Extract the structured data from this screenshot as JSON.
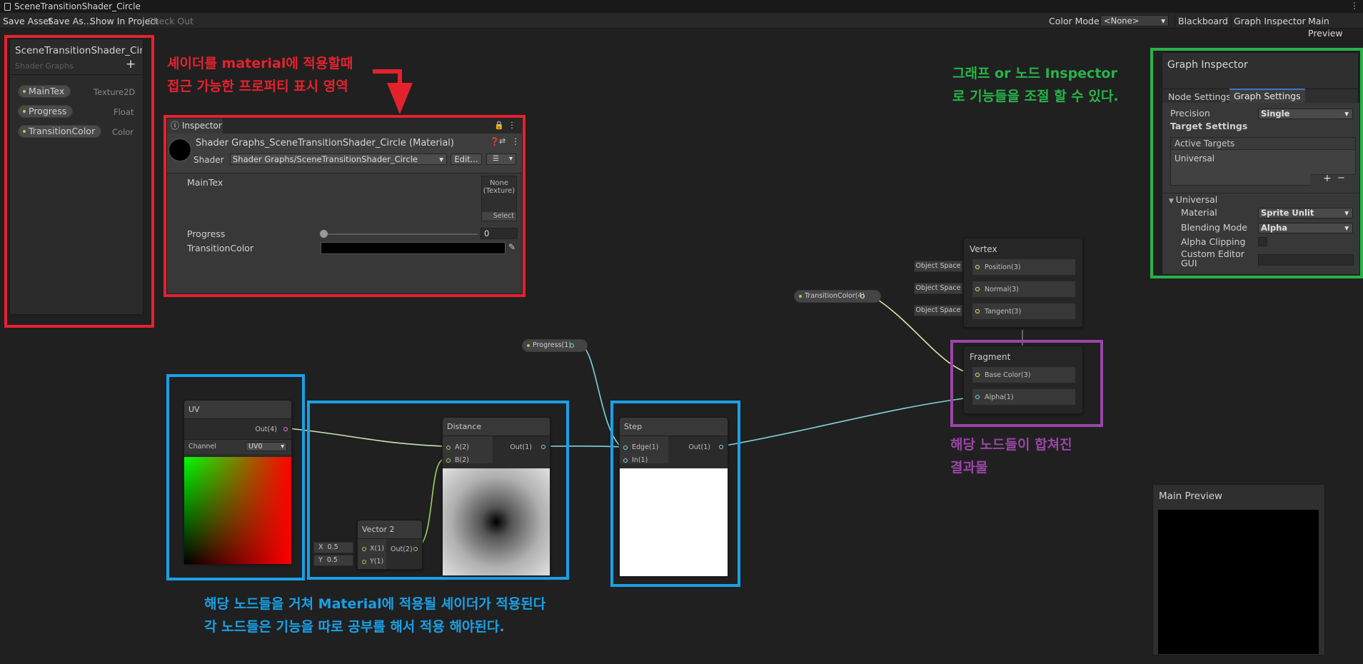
{
  "window": {
    "title": "SceneTransitionShader_Circle"
  },
  "toolbar": {
    "save_asset": "Save Asset",
    "save_as": "Save As...",
    "show_in_project": "Show In Project",
    "check_out": "Check Out",
    "color_mode_label": "Color Mode",
    "color_mode_value": "<None>",
    "blackboard": "Blackboard",
    "graph_inspector": "Graph Inspector",
    "main_preview": "Main Preview"
  },
  "blackboard": {
    "title": "SceneTransitionShader_Cir",
    "subtitle": "Shader Graphs",
    "add": "+",
    "properties": [
      {
        "name": "MainTex",
        "type": "Texture2D"
      },
      {
        "name": "Progress",
        "type": "Float"
      },
      {
        "name": "TransitionColor",
        "type": "Color"
      }
    ]
  },
  "inspector": {
    "tab": "Inspector",
    "material_title": "Shader Graphs_SceneTransitionShader_Circle (Material)",
    "shader_label": "Shader",
    "shader_value": "Shader Graphs/SceneTransitionShader_Circle",
    "edit_button": "Edit...",
    "maintex_label": "MainTex",
    "texture_none": "None",
    "texture_type": "(Texture)",
    "select_button": "Select",
    "progress_label": "Progress",
    "progress_value": "0",
    "progress_fraction": 0,
    "transition_color_label": "TransitionColor",
    "transition_color_value": "#000000"
  },
  "graph_inspector": {
    "title": "Graph Inspector",
    "tabs": [
      "Node Settings",
      "Graph Settings"
    ],
    "precision_label": "Precision",
    "precision_value": "Single",
    "target_settings": "Target Settings",
    "active_targets": "Active Targets",
    "target": "Universal",
    "add": "+",
    "remove": "−",
    "universal_header": "Universal",
    "material_label": "Material",
    "material_value": "Sprite Unlit",
    "blending_label": "Blending Mode",
    "blending_value": "Alpha",
    "alpha_clipping_label": "Alpha Clipping",
    "custom_editor_label": "Custom Editor",
    "custom_editor_label2": "GUI"
  },
  "nodes": {
    "transition_color": "TransitionColor(4)",
    "progress": "Progress(1)",
    "uv": {
      "title": "UV",
      "out": "Out(4)",
      "channel_label": "Channel",
      "channel_value": "UV0"
    },
    "distance": {
      "title": "Distance",
      "a": "A(2)",
      "b": "B(2)",
      "out": "Out(1)"
    },
    "vector2": {
      "title": "Vector 2",
      "x_label": "X",
      "x_value": "0.5",
      "y_label": "Y",
      "y_value": "0.5",
      "x_port": "X(1)",
      "y_port": "Y(1)",
      "out": "Out(2)"
    },
    "step": {
      "title": "Step",
      "edge": "Edge(1)",
      "in": "In(1)",
      "out": "Out(1)"
    },
    "vertex": {
      "title": "Vertex",
      "space": "Object Space",
      "position": "Position(3)",
      "normal": "Normal(3)",
      "tangent": "Tangent(3)"
    },
    "fragment": {
      "title": "Fragment",
      "base_color": "Base Color(3)",
      "alpha": "Alpha(1)"
    }
  },
  "main_preview": {
    "title": "Main Preview"
  },
  "annotations": {
    "red_1": "셰이더를 material에 적용할때",
    "red_2": "접근 가능한 프로퍼티 표시 영역",
    "green_1": "그래프 or 노드 Inspector",
    "green_2": "로 기능들을 조절 할 수 있다.",
    "purple_1": "해당 노드들이 합쳐진",
    "purple_2": "결과물",
    "blue_1": "해당 노드들을 거쳐 Material에 적용될 셰이더가 적용된다",
    "blue_2": "각 노드들은 기능을 따로 공부를 해서 적용 해야된다."
  },
  "colors": {
    "red": "#e4222e",
    "blue": "#1aa0e6",
    "green": "#28b34a",
    "purple": "#9b45a8"
  }
}
